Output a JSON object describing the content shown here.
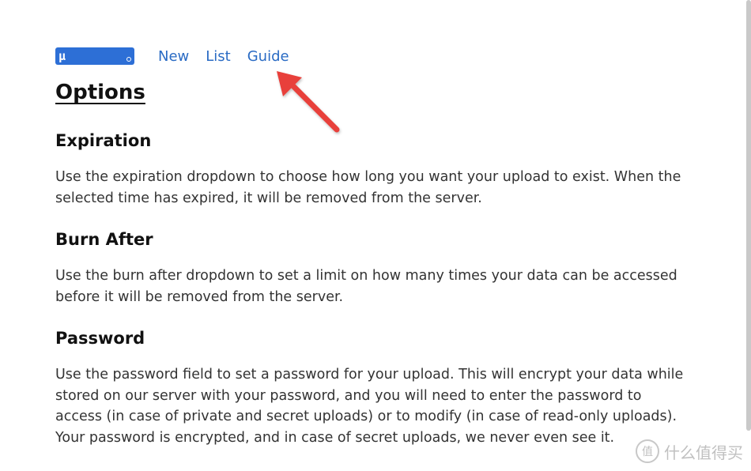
{
  "nav": {
    "logo_text": "μ",
    "links": [
      {
        "label": "New"
      },
      {
        "label": "List"
      },
      {
        "label": "Guide"
      }
    ]
  },
  "page_title": "Options",
  "sections": [
    {
      "heading": "Expiration",
      "body": "Use the expiration dropdown to choose how long you want your upload to exist. When the selected time has expired, it will be removed from the server."
    },
    {
      "heading": "Burn After",
      "body": "Use the burn after dropdown to set a limit on how many times your data can be accessed before it will be removed from the server."
    },
    {
      "heading": "Password",
      "body": "Use the password field to set a password for your upload. This will encrypt your data while stored on our server with your password, and you will need to enter the password to access (in case of private and secret uploads) or to modify (in case of read-only uploads). Your password is encrypted, and in case of secret uploads, we never even see it."
    }
  ],
  "annotation": {
    "arrow_color": "#e8403a",
    "target": "Guide"
  },
  "watermark": {
    "badge": "值",
    "text": "什么值得买"
  },
  "colors": {
    "link": "#2a6bc4",
    "logo_bg": "#2d6fd6"
  }
}
